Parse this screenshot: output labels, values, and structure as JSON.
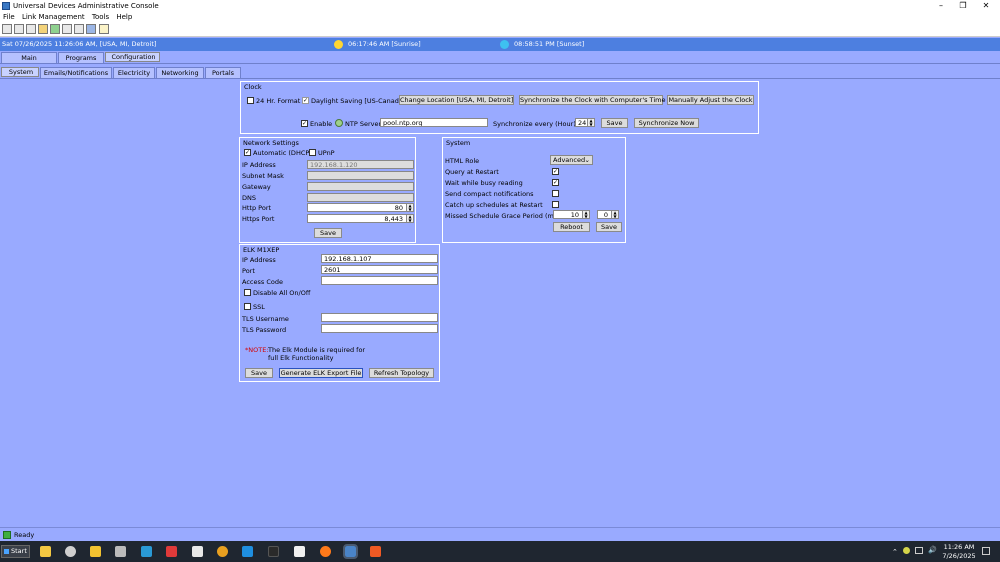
{
  "window": {
    "title": "Universal Devices Administrative Console"
  },
  "menu": [
    "File",
    "Link Management",
    "Tools",
    "Help"
  ],
  "status": {
    "datetime": "Sat 07/26/2025 11:26:06 AM,  [USA, MI, Detroit]",
    "sunrise": "06:17:46 AM [Sunrise]",
    "sunset": "08:58:51 PM [Sunset]"
  },
  "main_tabs": [
    "Main",
    "Programs",
    "Configuration"
  ],
  "sub_tabs": [
    "System",
    "Emails/Notifications",
    "Electricity",
    "Networking",
    "Portals"
  ],
  "clock": {
    "title": "Clock",
    "hr24": "24 Hr. Format",
    "dst": "Daylight Saving [US-Canada]",
    "change_location": "Change Location [USA, MI, Detroit]",
    "sync_clock": "Synchronize the Clock with Computer's Time",
    "manual_adjust": "Manually Adjust the Clock",
    "enable": "Enable",
    "ntp_server_label": "NTP Server",
    "ntp_server": "pool.ntp.org",
    "sync_every_label": "Synchronize every (Hour):",
    "sync_every": "24",
    "save": "Save",
    "sync_now": "Synchronize Now"
  },
  "network": {
    "title": "Network Settings",
    "dhcp": "Automatic (DHCP)",
    "upnp": "UPnP",
    "ip_label": "IP Address",
    "ip": "192.168.1.120",
    "subnet_label": "Subnet Mask",
    "gateway_label": "Gateway",
    "dns_label": "DNS",
    "http_label": "Http Port",
    "http": "80",
    "https_label": "Https Port",
    "https": "8,443",
    "save": "Save"
  },
  "system": {
    "title": "System",
    "html_role_label": "HTML Role",
    "html_role": "Advanced",
    "query_restart": "Query at Restart",
    "wait_busy": "Wait while busy reading",
    "send_compact": "Send compact notifications",
    "catch_up": "Catch up schedules at Restart",
    "grace_label": "Missed Schedule Grace Period (m:s)",
    "grace_m": "10",
    "grace_s": "0",
    "reboot": "Reboot",
    "save": "Save"
  },
  "elk": {
    "title": "ELK M1XEP",
    "ip_label": "IP Address",
    "ip": "192.168.1.107",
    "port_label": "Port",
    "port": "2601",
    "access_label": "Access Code",
    "disable_all": "Disable All On/Off",
    "ssl": "SSL",
    "tls_user_label": "TLS Username",
    "tls_pass_label": "TLS Password",
    "note_prefix": "*NOTE:",
    "note_line1": "The Elk Module is required for",
    "note_line2": "full Elk Functionality",
    "save": "Save",
    "generate": "Generate ELK Export File",
    "refresh": "Refresh Topology"
  },
  "footer": {
    "ready": "Ready"
  },
  "taskbar": {
    "start": "Start",
    "time": "11:26 AM",
    "date": "7/26/2025"
  }
}
